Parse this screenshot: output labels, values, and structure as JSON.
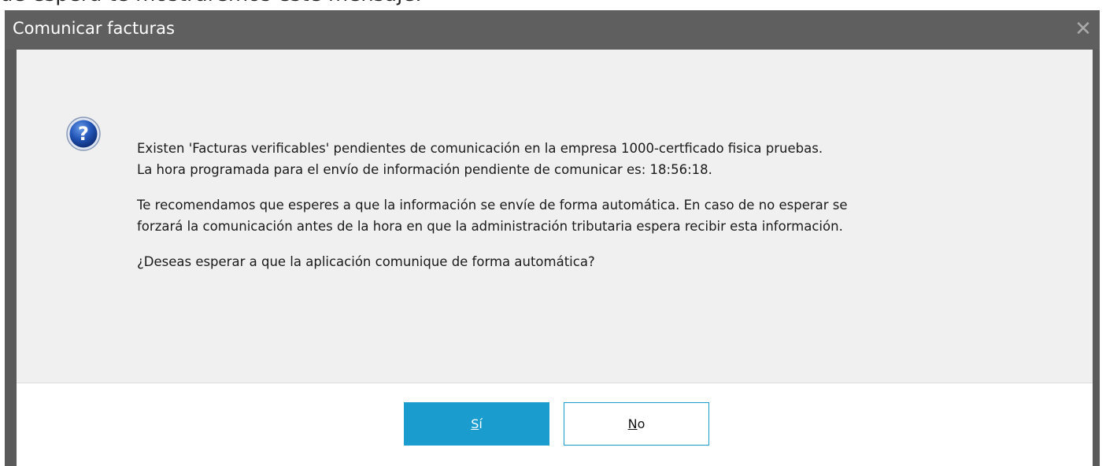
{
  "background": {
    "text": "de espera te mostraremos este mensaje."
  },
  "dialog": {
    "title": "Comunicar facturas",
    "close_icon": "close-icon",
    "icon": "question-icon",
    "message": {
      "line1": "Existen 'Facturas verificables' pendientes de comunicación en la empresa 1000-certficado fisica pruebas.",
      "line2": "La hora programada para el envío de información pendiente de comunicar es: 18:56:18.",
      "line3": "Te recomendamos que esperes a que la información se envíe de forma automática. En caso de no esperar se",
      "line4": "forzará la comunicación antes de la hora en que la administración tributaria espera recibir esta información.",
      "line5": "¿Deseas esperar a que la aplicación comunique de forma automática?"
    },
    "buttons": {
      "yes_mnemonic": "S",
      "yes_rest": "í",
      "no_mnemonic": "N",
      "no_rest": "o"
    }
  },
  "colors": {
    "titlebar": "#5f5f5f",
    "content_bg": "#f0f0f0",
    "accent": "#1a9ccf"
  }
}
